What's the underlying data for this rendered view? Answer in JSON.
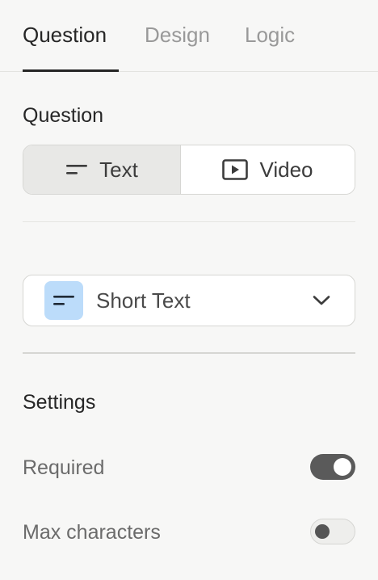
{
  "tabs": [
    {
      "label": "Question",
      "active": true
    },
    {
      "label": "Design",
      "active": false
    },
    {
      "label": "Logic",
      "active": false
    }
  ],
  "question_section": {
    "title": "Question",
    "modes": [
      {
        "label": "Text",
        "icon": "text-lines-icon",
        "selected": true
      },
      {
        "label": "Video",
        "icon": "video-play-icon",
        "selected": false
      }
    ]
  },
  "question_type": {
    "label": "Short Text",
    "icon": "short-text-icon",
    "icon_bg_color": "#bcdcfa",
    "dropdown_icon": "chevron-down-icon"
  },
  "settings": {
    "title": "Settings",
    "items": [
      {
        "label": "Required",
        "enabled": true
      },
      {
        "label": "Max characters",
        "enabled": false
      }
    ]
  },
  "colors": {
    "background": "#f7f7f6",
    "text_primary": "#262626",
    "text_muted": "#999999",
    "toggle_on": "#5a5a5a",
    "accent_icon_bg": "#bcdcfa"
  }
}
